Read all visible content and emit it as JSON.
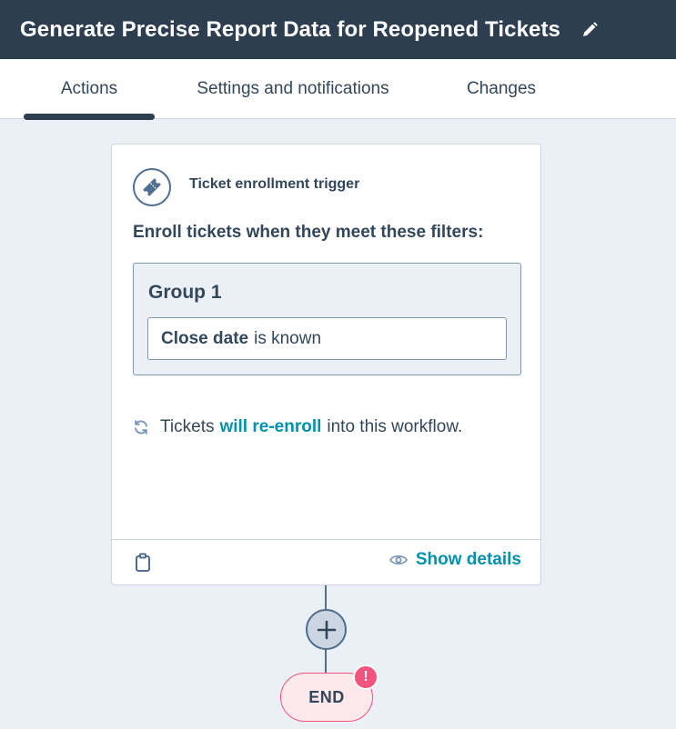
{
  "header": {
    "title": "Generate Precise Report Data for Reopened Tickets",
    "edit_icon": "pencil-icon"
  },
  "tabs": [
    {
      "label": "Actions",
      "active": true
    },
    {
      "label": "Settings and notifications",
      "active": false
    },
    {
      "label": "Changes",
      "active": false
    }
  ],
  "trigger_card": {
    "icon": "ticket-icon",
    "trigger_label": "Ticket enrollment trigger",
    "enroll_heading": "Enroll tickets when they meet these filters:",
    "groups": [
      {
        "title": "Group 1",
        "filters": [
          {
            "property": "Close date",
            "operator": "is known"
          }
        ]
      }
    ],
    "reenroll": {
      "icon": "refresh-icon",
      "prefix": "Tickets",
      "link": "will re-enroll",
      "suffix": "into this workflow."
    },
    "footer": {
      "clipboard_icon": "clipboard-icon",
      "show_details_label": "Show details",
      "eye_icon": "eye-icon"
    }
  },
  "flow": {
    "add_icon": "plus-icon",
    "end_label": "END",
    "alert_badge": "!"
  },
  "colors": {
    "header_bg": "#2d3e50",
    "canvas_bg": "#eaf0f6",
    "link": "#0091ae",
    "alert": "#f2547d",
    "text": "#33475b"
  }
}
